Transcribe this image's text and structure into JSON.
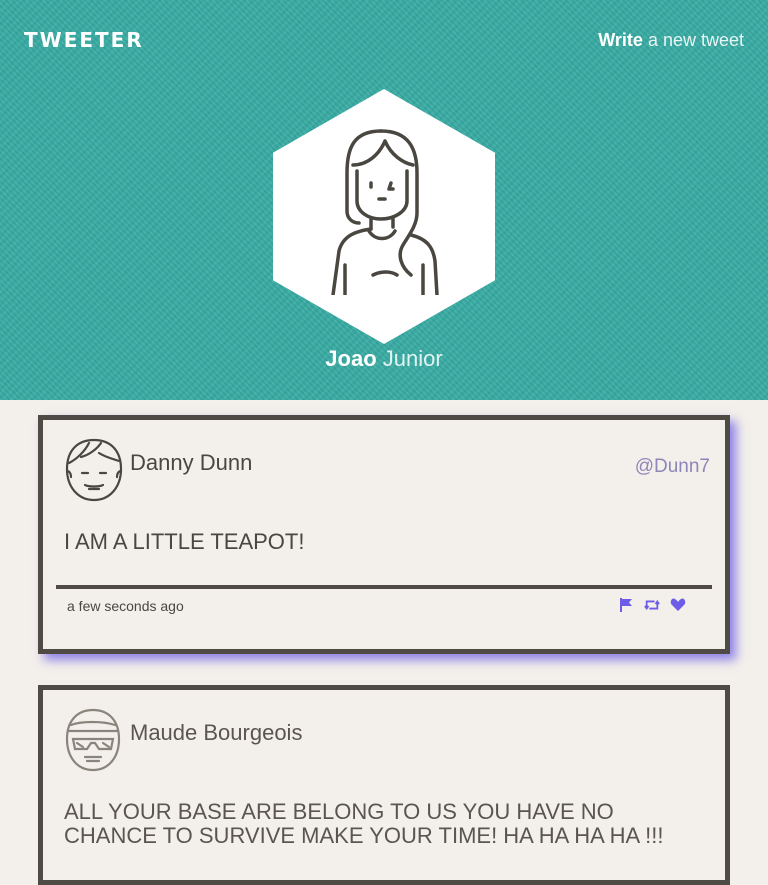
{
  "nav": {
    "brand": "TWEETER",
    "compose_strong": "Write",
    "compose_rest": "a new tweet"
  },
  "profile": {
    "first_name": "Joao",
    "last_name": "Junior"
  },
  "colors": {
    "header_bg": "#36aaa2",
    "accent": "#6c5ce7",
    "handle": "#8e86b8"
  },
  "tweets": [
    {
      "author": "Danny Dunn",
      "handle": "@Dunn7",
      "text": "I AM A LITTLE TEAPOT!",
      "timestamp": "a few seconds ago",
      "actions": [
        "flag-icon",
        "retweet-icon",
        "heart-icon"
      ]
    },
    {
      "author": "Maude Bourgeois",
      "text": "ALL YOUR BASE ARE BELONG TO US YOU HAVE NO CHANCE TO SURVIVE MAKE YOUR TIME! HA HA HA HA !!!"
    }
  ]
}
